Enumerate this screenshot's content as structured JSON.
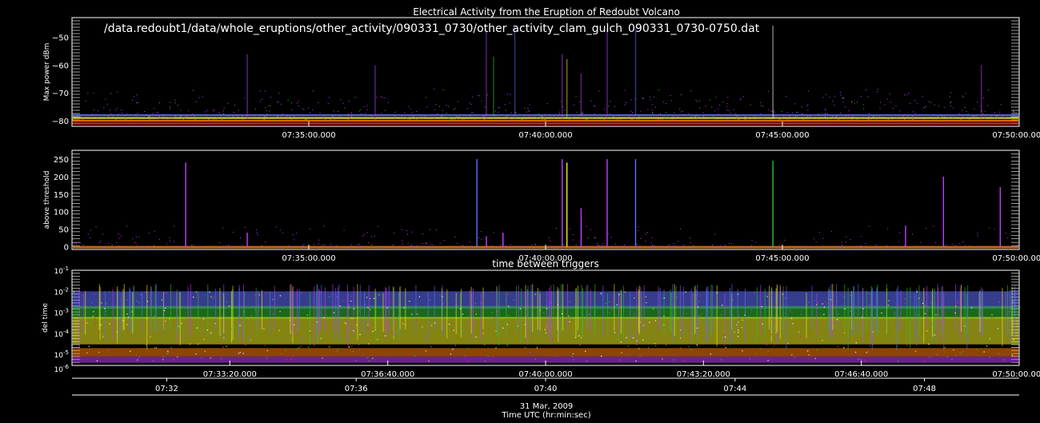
{
  "title": "Electrical Activity from the Eruption of Redoubt Volcano",
  "file_path": "/data.redoubt1/data/whole_eruptions/other_activity/090331_0730/other_activity_clam_gulch_090331_0730-0750.dat",
  "colors": {
    "background": "#000000",
    "axes": "#ffffff",
    "purple": "#c040ff",
    "blue": "#6070ff",
    "green": "#30c030",
    "yellow": "#f0f020",
    "orange": "#ff8000",
    "red": "#ff2020",
    "white": "#ffffff"
  },
  "footer": {
    "date": "31 Mar, 2009",
    "xlabel": "Time UTC (hr:min:sec)"
  },
  "chart_data": [
    {
      "type": "scatter",
      "title": "",
      "ylabel": "Max power dBm",
      "xlim": [
        "07:30:00",
        "07:50:00"
      ],
      "ylim": [
        -82,
        -43
      ],
      "yticks": [
        -80,
        -70,
        -60,
        -50
      ],
      "ytick_labels": [
        "−80",
        "−70",
        "−60",
        "−50"
      ],
      "xtick_labels": [
        "07:35:00.000",
        "07:40:00.000",
        "07:45:00.000",
        "07:50:00.000"
      ],
      "xtick_minutes": [
        5,
        10,
        15,
        20
      ],
      "baseline_levels": [
        -81,
        -80,
        -79,
        -78
      ],
      "spikes": [
        {
          "t_min": 3.7,
          "peak": -56,
          "color": "purple"
        },
        {
          "t_min": 6.4,
          "peak": -60,
          "color": "purple"
        },
        {
          "t_min": 8.75,
          "peak": -47,
          "color": "purple"
        },
        {
          "t_min": 8.9,
          "peak": -57,
          "color": "green"
        },
        {
          "t_min": 9.35,
          "peak": -46,
          "color": "blue"
        },
        {
          "t_min": 10.35,
          "peak": -56,
          "color": "purple"
        },
        {
          "t_min": 10.45,
          "peak": -58,
          "color": "yellow"
        },
        {
          "t_min": 10.75,
          "peak": -63,
          "color": "purple"
        },
        {
          "t_min": 11.3,
          "peak": -47,
          "color": "purple"
        },
        {
          "t_min": 11.9,
          "peak": -47,
          "color": "blue"
        },
        {
          "t_min": 14.8,
          "peak": -46,
          "color": "white"
        },
        {
          "t_min": 19.2,
          "peak": -60,
          "color": "purple"
        }
      ]
    },
    {
      "type": "scatter",
      "title": "",
      "ylabel": "above threshold",
      "xlim": [
        "07:30:00",
        "07:50:00"
      ],
      "ylim": [
        -8,
        275
      ],
      "yticks": [
        0,
        50,
        100,
        150,
        200,
        250
      ],
      "ytick_labels": [
        "0",
        "50",
        "100",
        "150",
        "200",
        "250"
      ],
      "xtick_labels": [
        "07:35:00.000",
        "07:40:00.000",
        "07:45:00.000",
        "07:50:00.000"
      ],
      "xtick_minutes": [
        5,
        10,
        15,
        20
      ],
      "spikes": [
        {
          "t_min": 2.4,
          "peak": 240,
          "color": "purple"
        },
        {
          "t_min": 3.7,
          "peak": 40,
          "color": "purple"
        },
        {
          "t_min": 8.55,
          "peak": 250,
          "color": "blue"
        },
        {
          "t_min": 8.75,
          "peak": 30,
          "color": "purple"
        },
        {
          "t_min": 9.1,
          "peak": 40,
          "color": "purple"
        },
        {
          "t_min": 10.35,
          "peak": 250,
          "color": "purple"
        },
        {
          "t_min": 10.45,
          "peak": 240,
          "color": "yellow"
        },
        {
          "t_min": 10.75,
          "peak": 110,
          "color": "purple"
        },
        {
          "t_min": 11.3,
          "peak": 250,
          "color": "purple"
        },
        {
          "t_min": 11.9,
          "peak": 250,
          "color": "blue"
        },
        {
          "t_min": 14.8,
          "peak": 245,
          "color": "green"
        },
        {
          "t_min": 17.6,
          "peak": 60,
          "color": "purple"
        },
        {
          "t_min": 18.4,
          "peak": 200,
          "color": "purple"
        },
        {
          "t_min": 19.6,
          "peak": 170,
          "color": "purple"
        }
      ]
    },
    {
      "type": "scatter",
      "title": "time between triggers",
      "ylabel": "del time",
      "yscale": "log",
      "xlim": [
        "07:30:00",
        "07:50:00"
      ],
      "ylim": [
        3e-06,
        0.1
      ],
      "ytick_values": [
        1e-06,
        1e-05,
        0.0001,
        0.001,
        0.01,
        0.1
      ],
      "ytick_labels": [
        [
          "10",
          "-6"
        ],
        [
          "10",
          "-5"
        ],
        [
          "10",
          "-4"
        ],
        [
          "10",
          "-3"
        ],
        [
          "10",
          "-2"
        ],
        [
          "10",
          "-1"
        ]
      ],
      "xtick_labels": [
        "07:33:20.000",
        "07:36:40.000",
        "07:40:00.000",
        "07:43:20.000",
        "07:46:40.000",
        "07:50:00.000"
      ],
      "xtick_minutes": [
        3.333,
        6.667,
        10,
        13.333,
        16.667,
        20
      ],
      "bands": [
        {
          "lo": 0.0015,
          "hi": 0.01,
          "color": "blue"
        },
        {
          "lo": 0.0005,
          "hi": 0.002,
          "color": "green"
        },
        {
          "lo": 3e-05,
          "hi": 0.0006,
          "color": "yellow"
        },
        {
          "lo": 8e-06,
          "hi": 2e-05,
          "color": "orange"
        },
        {
          "lo": 4e-06,
          "hi": 8e-06,
          "color": "purple"
        }
      ]
    }
  ],
  "time_axis": {
    "tick_labels": [
      "07:32",
      "07:36",
      "07:40",
      "07:44",
      "07:48"
    ],
    "tick_minutes": [
      2,
      6,
      10,
      14,
      18
    ]
  }
}
